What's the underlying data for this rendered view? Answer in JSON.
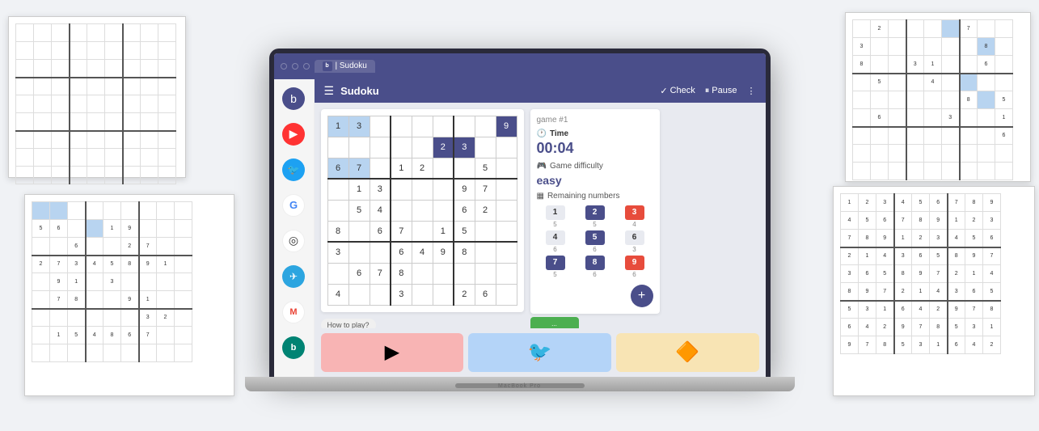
{
  "browser": {
    "tab_icon": "b",
    "tab_label": "| Sudoku"
  },
  "sidebar": {
    "icons": [
      {
        "name": "app-icon",
        "symbol": "b",
        "style": "blue"
      },
      {
        "name": "youtube-icon",
        "symbol": "▶",
        "style": "red"
      },
      {
        "name": "twitter-icon",
        "symbol": "🐦",
        "style": "twitter"
      },
      {
        "name": "google-icon",
        "symbol": "G",
        "style": "google"
      },
      {
        "name": "openai-icon",
        "symbol": "◎",
        "style": "openai"
      },
      {
        "name": "telegram-icon",
        "symbol": "✈",
        "style": "telegram"
      },
      {
        "name": "gmail-icon",
        "symbol": "M",
        "style": "gmail"
      },
      {
        "name": "bing-icon",
        "symbol": "b",
        "style": "bing"
      }
    ]
  },
  "header": {
    "hamburger": "☰",
    "title": "Sudoku",
    "check_label": "Check",
    "pause_label": "Pause",
    "more_icon": "⋮"
  },
  "game": {
    "game_number": "game #1",
    "time_label": "Time",
    "time_value": "00:04",
    "difficulty_label": "Game difficulty",
    "difficulty_value": "easy",
    "remaining_label": "Remaining numbers",
    "numbers": [
      {
        "value": "1",
        "count": "5",
        "active": false
      },
      {
        "value": "2",
        "count": "5",
        "active": true
      },
      {
        "value": "3",
        "count": "4",
        "active": true
      },
      {
        "value": "4",
        "count": "6",
        "active": false
      },
      {
        "value": "5",
        "count": "6",
        "active": true
      },
      {
        "value": "6",
        "count": "3",
        "active": false
      },
      {
        "value": "7",
        "count": "5",
        "active": true
      },
      {
        "value": "8",
        "count": "6",
        "active": true
      },
      {
        "value": "9",
        "count": "6",
        "active": true
      }
    ],
    "fab_icon": "+"
  },
  "how_to_play": "How to play?",
  "laptop_label": "MacBook Pro",
  "bg_grids": {
    "top_right": [
      [
        "",
        "2",
        "",
        "",
        "",
        "",
        "7",
        "",
        ""
      ],
      [
        "3",
        "",
        "",
        "",
        "",
        "",
        "",
        "8",
        ""
      ],
      [
        "8",
        "",
        "",
        "3",
        "1",
        "",
        "",
        "6",
        ""
      ],
      [
        "",
        "5",
        "",
        "",
        "4",
        "",
        "",
        "",
        ""
      ],
      [
        "",
        "",
        "",
        "",
        "",
        "",
        "8",
        "",
        "5"
      ],
      [
        "",
        "6",
        "",
        "",
        "",
        "3",
        "",
        "",
        "1"
      ],
      [
        "",
        "",
        "",
        "",
        "",
        "",
        "",
        "",
        "6"
      ],
      [
        "",
        "",
        "",
        "",
        "",
        "",
        "",
        "",
        ""
      ],
      [
        "",
        "",
        "",
        "",
        "",
        "",
        "",
        "",
        ""
      ]
    ],
    "bottom_right": [
      [
        "1",
        "2",
        "3",
        "4",
        "5",
        "6",
        "7",
        "8",
        "9"
      ],
      [
        "4",
        "5",
        "6",
        "7",
        "8",
        "9",
        "1",
        "2",
        "3"
      ],
      [
        "7",
        "8",
        "9",
        "1",
        "2",
        "3",
        "4",
        "5",
        "6"
      ],
      [
        "2",
        "1",
        "4",
        "3",
        "6",
        "5",
        "8",
        "9",
        "7"
      ],
      [
        "3",
        "6",
        "5",
        "8",
        "9",
        "7",
        "2",
        "1",
        "4"
      ],
      [
        "8",
        "9",
        "7",
        "2",
        "1",
        "4",
        "3",
        "6",
        "5"
      ],
      [
        "5",
        "3",
        "1",
        "6",
        "4",
        "2",
        "9",
        "7",
        "8"
      ],
      [
        "6",
        "4",
        "2",
        "9",
        "7",
        "8",
        "5",
        "3",
        "1"
      ],
      [
        "9",
        "7",
        "8",
        "5",
        "3",
        "1",
        "6",
        "4",
        "2"
      ]
    ]
  },
  "promo": {
    "cards": [
      {
        "style": "pink",
        "icon": "▶"
      },
      {
        "style": "blue",
        "icon": "🐦"
      },
      {
        "style": "yellow",
        "icon": "🔶"
      }
    ]
  }
}
